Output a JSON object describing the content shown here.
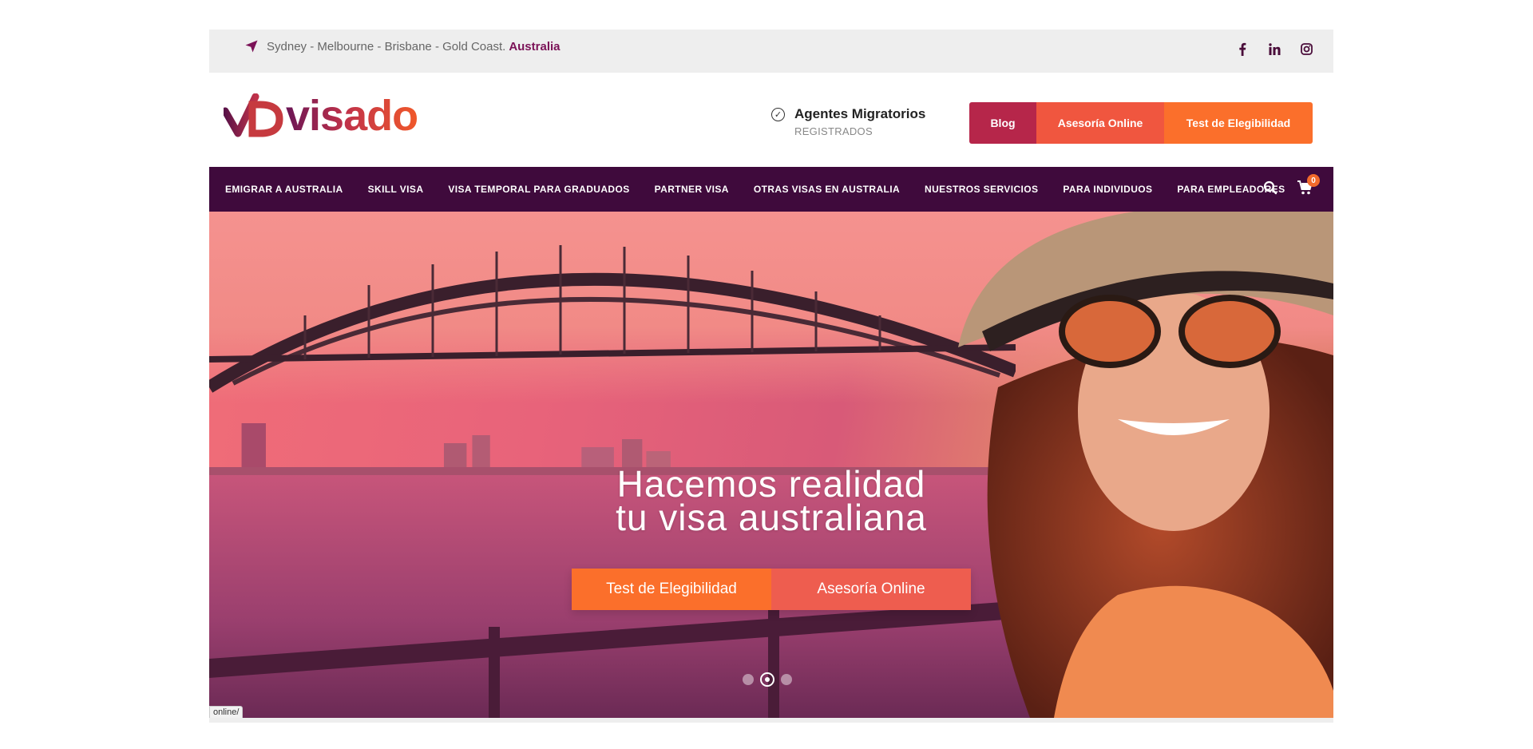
{
  "topbar": {
    "location_text": "Sydney - Melbourne - Brisbane - Gold Coast.",
    "country": "Australia",
    "social": [
      "facebook-icon",
      "linkedin-icon",
      "instagram-icon"
    ]
  },
  "header": {
    "logo_text": "visado",
    "agents_title": "Agentes Migratorios",
    "agents_sub": "REGISTRADOS",
    "buttons": [
      "Blog",
      "Asesoría Online",
      "Test de Elegibilidad"
    ]
  },
  "nav": {
    "items": [
      "EMIGRAR A AUSTRALIA",
      "SKILL VISA",
      "VISA TEMPORAL PARA GRADUADOS",
      "PARTNER VISA",
      "OTRAS VISAS EN AUSTRALIA",
      "NUESTROS SERVICIOS",
      "PARA INDIVIDUOS",
      "PARA EMPLEADORES"
    ],
    "cart_count": "0"
  },
  "hero": {
    "title_line1": "Hacemos realidad",
    "title_line2": "tu visa australiana",
    "btn_test": "Test de Elegibilidad",
    "btn_asesoria": "Asesoría Online",
    "slides": 3,
    "active_slide": 2
  },
  "status_tip": "online/",
  "colors": {
    "nav_bg": "#3f0a3c",
    "accent_orange": "#fb6f2b",
    "accent_red": "#b6264a",
    "accent_coral": "#f0563f",
    "brand_purple": "#7b1257"
  }
}
